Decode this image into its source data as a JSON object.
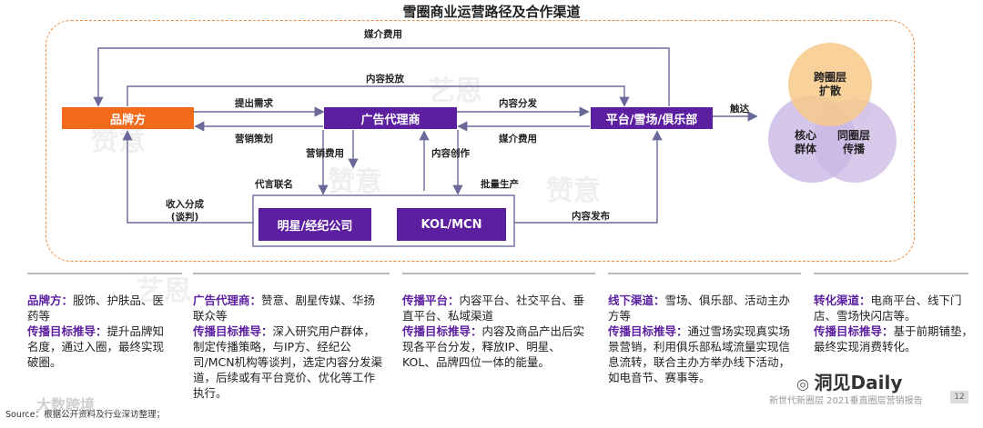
{
  "title": "雪圈商业运营路径及合作渠道",
  "nodes": {
    "brand": "品牌方",
    "agency": "广告代理商",
    "platform": "平台/雪场/俱乐部",
    "star": "明星/经纪公司",
    "kol": "KOL/MCN"
  },
  "circles": {
    "top_line1": "跨圈层",
    "top_line2": "扩散",
    "left_line1": "核心",
    "left_line2": "群体",
    "right_line1": "同圈层",
    "right_line2": "传播"
  },
  "edges": {
    "media_fee_top": "媒介费用",
    "content_placement": "内容投放",
    "raise_demand": "提出需求",
    "marketing_plan": "营销策划",
    "content_distribution": "内容分发",
    "media_fee_mid": "媒介费用",
    "reach": "触达",
    "marketing_fee": "营销费用",
    "content_creation": "内容创作",
    "endorsement": "代言联名",
    "batch_production": "批量生产",
    "revenue_share_1": "收入分成",
    "revenue_share_2": "(谈判)",
    "content_publish": "内容发布"
  },
  "columns": [
    {
      "head1": "品牌方：",
      "text1": "服饰、护肤品、医药等",
      "head2": "传播目标推导：",
      "text2": "提升品牌知名度，通过入圈，最终实现破圈。"
    },
    {
      "head1": "广告代理商：",
      "text1": "赞意、剧星传媒、华扬联众等",
      "head2": "传播目标推导：",
      "text2": "深入研究用户群体，制定传播策略，与IP方、经纪公司/MCN机构等谈判，选定内容分发渠道，后续或有平台竞价、优化等工作执行。"
    },
    {
      "head1": "传播平台：",
      "text1": "内容平台、社交平台、垂直平台、私域渠道",
      "head2": "传播目标推导：",
      "text2": "内容及商品产出后实现各平台分发，释放IP、明星、KOL、品牌四位一体的能量。"
    },
    {
      "head1": "线下渠道：",
      "text1": "雪场、俱乐部、活动主办方等",
      "head2": "传播目标推导：",
      "text2": "通过雪场实现真实场景营销，利用俱乐部私域流量实现信息流转，联合主办方举办线下活动，如电音节、赛事等。"
    },
    {
      "head1": "转化渠道：",
      "text1": "电商平台、线下门店、雪场快闪店等。",
      "head2": "传播目标推导：",
      "text2": "基于前期铺垫，最终实现消费转化。"
    }
  ],
  "footer": {
    "source": "Source：根据公开资料及行业深访整理；",
    "report": "新世代新圈层 2021垂直圈层营销报告",
    "page": "12",
    "logo": "洞见Daily",
    "watermark1": "赞意",
    "watermark2": "艺恩",
    "watermark3": "大数跨境"
  },
  "colors": {
    "brand": "#f26b1d",
    "purple": "#5b1fa0",
    "frame": "#f08a3c",
    "circle_top": "#f7c98a",
    "circle_left": "#c9b8e6",
    "circle_right": "#cbb7e3"
  }
}
